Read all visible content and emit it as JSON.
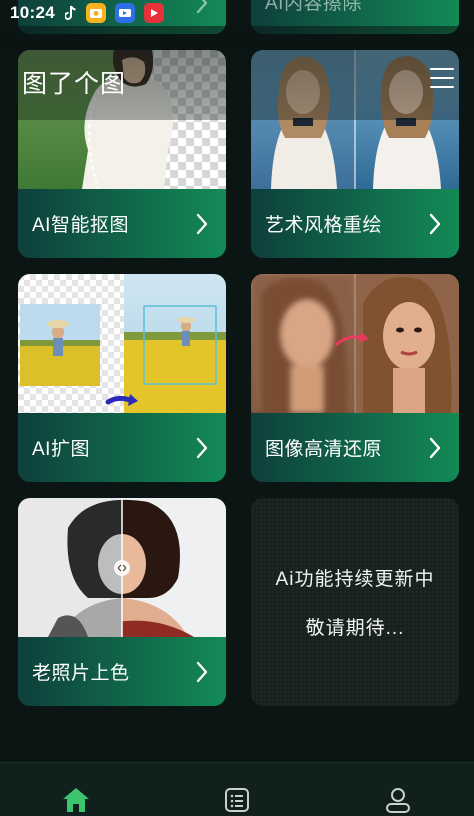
{
  "status_bar": {
    "time": "10:24",
    "icons": [
      "tiktok-icon",
      "camera-app-icon",
      "tv-app-icon",
      "video-app-icon"
    ]
  },
  "header": {
    "title": "图了个图",
    "menu_icon": "hamburger-menu-icon"
  },
  "partial_cards": [
    {
      "label": ""
    },
    {
      "label": "AI内容擦除"
    }
  ],
  "cards": [
    {
      "label": "AI智能抠图",
      "image": "cutout-preview"
    },
    {
      "label": "艺术风格重绘",
      "image": "style-redraw-preview"
    },
    {
      "label": "AI扩图",
      "image": "outpaint-preview"
    },
    {
      "label": "图像高清还原",
      "image": "hd-restore-preview"
    },
    {
      "label": "老照片上色",
      "image": "colorize-preview"
    }
  ],
  "coming_soon": {
    "line1": "Ai功能持续更新中",
    "line2": "敬请期待..."
  },
  "bottom_nav": {
    "items": [
      {
        "icon": "home-icon",
        "active": true
      },
      {
        "icon": "list-icon",
        "active": false
      },
      {
        "icon": "profile-icon",
        "active": false
      }
    ]
  },
  "colors": {
    "accent_green": "#3cc46f",
    "card_gradient_start": "#0e3f3c",
    "card_gradient_end": "#138a56",
    "background": "#0b1614"
  }
}
